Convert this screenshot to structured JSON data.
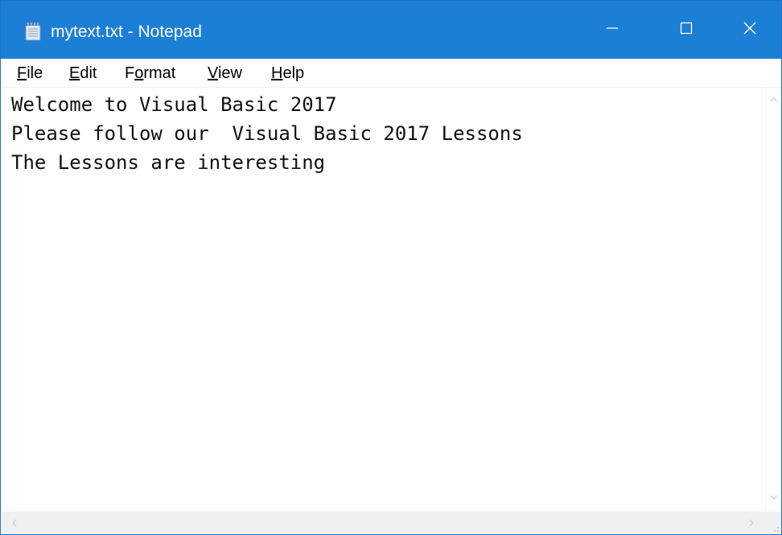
{
  "window": {
    "title": "mytext.txt - Notepad",
    "titlebar_color": "#1b7fd6",
    "controls": {
      "minimize": "minimize-icon",
      "maximize": "maximize-icon",
      "close": "close-icon"
    }
  },
  "menu": {
    "items": [
      {
        "label": "File",
        "accesskey": "F"
      },
      {
        "label": "Edit",
        "accesskey": "E"
      },
      {
        "label": "Format",
        "accesskey": "o"
      },
      {
        "label": "View",
        "accesskey": "V"
      },
      {
        "label": "Help",
        "accesskey": "H"
      }
    ]
  },
  "editor": {
    "lines": [
      "Welcome to Visual Basic 2017",
      "Please follow our  Visual Basic 2017 Lessons",
      "The Lessons are interesting"
    ]
  },
  "icons": {
    "app": "notepad-icon",
    "scroll_up": "chevron-up-icon",
    "scroll_down": "chevron-down-icon",
    "scroll_left": "chevron-left-icon",
    "scroll_right": "chevron-right-icon",
    "grip": "size-grip-icon"
  }
}
